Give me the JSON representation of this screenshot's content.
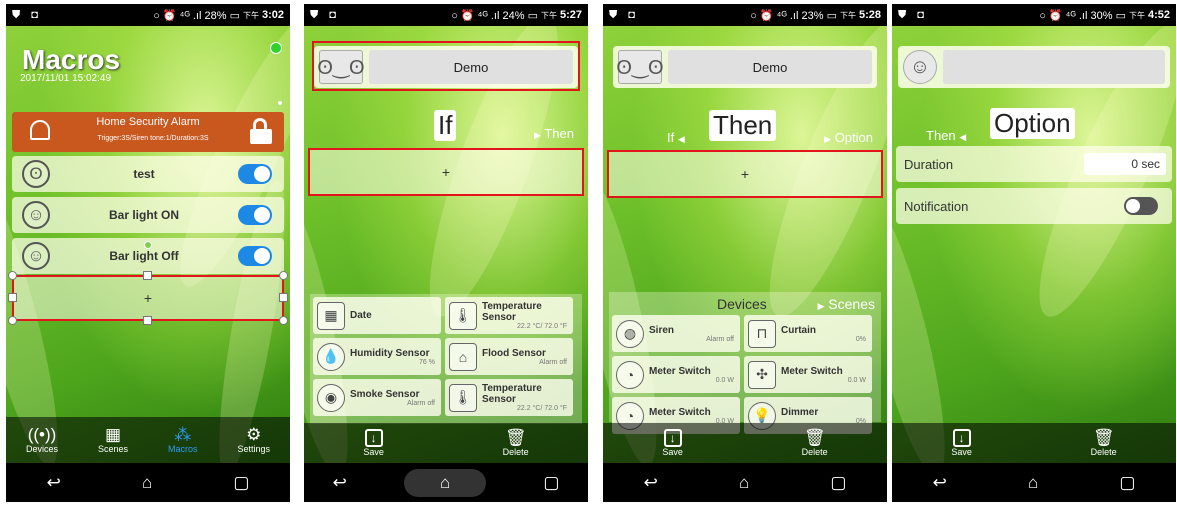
{
  "status_bars": [
    {
      "left": "⛊ ◘",
      "right": "○ ⏰ ⁴ᴳ .ıl 28% ▭",
      "time_prefix": "下午",
      "time": "3:02"
    },
    {
      "left": "⛊ ◘",
      "right": "○ ⏰ ⁴ᴳ .ıl 24% ▭",
      "time_prefix": "下午",
      "time": "5:27"
    },
    {
      "left": "⛊ ◘",
      "right": "○ ⏰ ⁴ᴳ .ıl 23% ▭",
      "time_prefix": "下午",
      "time": "5:28"
    },
    {
      "left": "⛊ ◘",
      "right": "○ ⏰ ⁴ᴳ .ıl 30% ▭",
      "time_prefix": "下午",
      "time": "4:52"
    }
  ],
  "screen1": {
    "title": "Macros",
    "datetime": "2017/11/01 15:02:49",
    "alarm": {
      "title": "Home Security Alarm",
      "detail": "Trigger:3S/Siren tone:1/Duration:3S"
    },
    "macros": [
      {
        "label": "test",
        "icon": "panda-icon",
        "enabled": true
      },
      {
        "label": "Bar light ON",
        "icon": "smiley-icon",
        "enabled": true
      },
      {
        "label": "Bar light Off",
        "icon": "smiley-icon",
        "enabled": true
      }
    ],
    "add_label": "+",
    "tabs": [
      {
        "label": "Devices",
        "icon": "devices-icon"
      },
      {
        "label": "Scenes",
        "icon": "scenes-icon"
      },
      {
        "label": "Macros",
        "icon": "macros-icon",
        "active": true
      },
      {
        "label": "Settings",
        "icon": "gear-icon"
      }
    ]
  },
  "screen2": {
    "name": "Demo",
    "section": "If",
    "next": "Then",
    "add_label": "+",
    "sensors": [
      {
        "name": "Date",
        "sub": ""
      },
      {
        "name": "Temperature Sensor",
        "sub": "22.2 °C/ 72.0 °F"
      },
      {
        "name": "Humidity Sensor",
        "sub": "76 %"
      },
      {
        "name": "Flood Sensor",
        "sub": "Alarm off"
      },
      {
        "name": "Smoke Sensor",
        "sub": "Alarm off"
      },
      {
        "name": "Temperature Sensor",
        "sub": "22.2 °C/ 72.0 °F"
      }
    ],
    "save_label": "Save",
    "delete_label": "Delete"
  },
  "screen3": {
    "name": "Demo",
    "prev": "If",
    "section": "Then",
    "next": "Option",
    "add_label": "+",
    "tab_devices": "Devices",
    "tab_scenes": "Scenes",
    "devices": [
      {
        "name": "Siren",
        "sub": "Alarm off"
      },
      {
        "name": "Curtain",
        "sub": "0%"
      },
      {
        "name": "Meter Switch",
        "sub": "0.0 W"
      },
      {
        "name": "Meter Switch",
        "sub": "0.0 W"
      },
      {
        "name": "Meter Switch",
        "sub": "0.0 W"
      },
      {
        "name": "Dimmer",
        "sub": "0%"
      }
    ],
    "save_label": "Save",
    "delete_label": "Delete"
  },
  "screen4": {
    "prev": "Then",
    "section": "Option",
    "duration_label": "Duration",
    "duration_value": "0 sec",
    "notification_label": "Notification",
    "save_label": "Save",
    "delete_label": "Delete"
  },
  "nav": {
    "back": "↩",
    "home": "⌂",
    "recent": "▢"
  }
}
